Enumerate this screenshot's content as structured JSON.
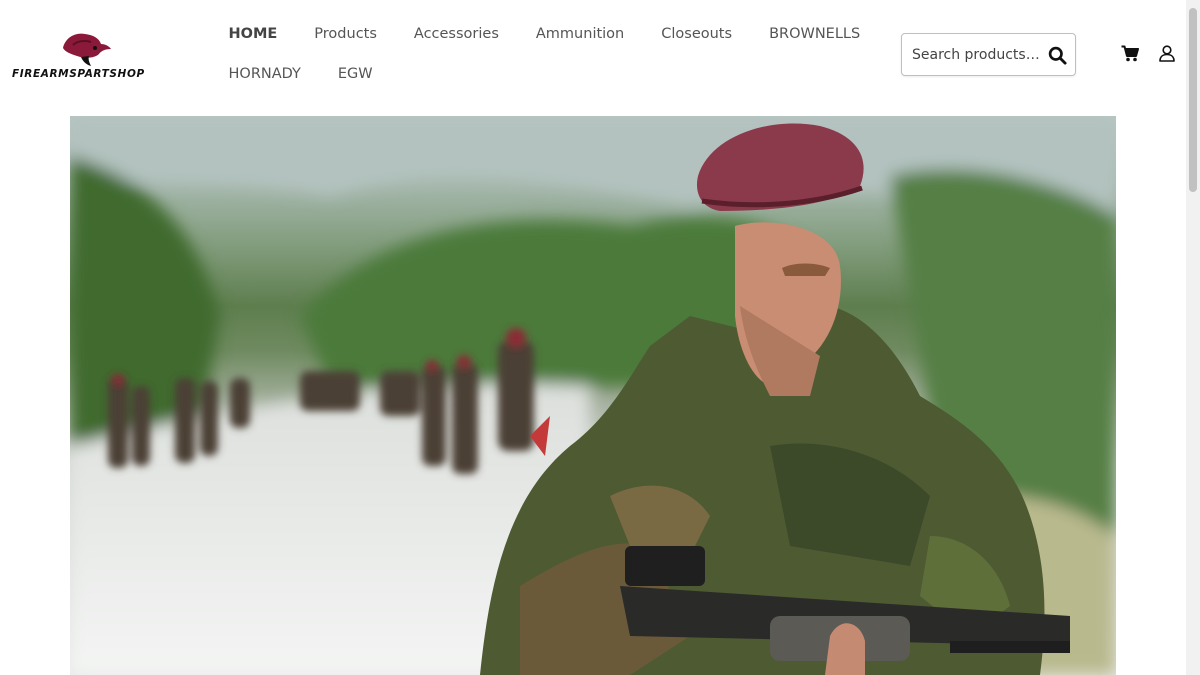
{
  "brand": {
    "name": "FIREARMSPARTSHOP",
    "accent_color": "#8b1a3a"
  },
  "nav": {
    "row1": [
      {
        "label": "HOME",
        "active": true
      },
      {
        "label": "Products"
      },
      {
        "label": "Accessories"
      },
      {
        "label": "Ammunition"
      },
      {
        "label": "Closeouts"
      },
      {
        "label": "BROWNELLS"
      }
    ],
    "row2": [
      {
        "label": "HORNADY"
      },
      {
        "label": "EGW"
      }
    ]
  },
  "search": {
    "placeholder": "Search products…",
    "icon": "search-icon"
  },
  "header_icons": {
    "cart": "cart-icon",
    "account": "user-icon"
  },
  "hero": {
    "image": "soldier-maroon-beret-with-rifle"
  }
}
